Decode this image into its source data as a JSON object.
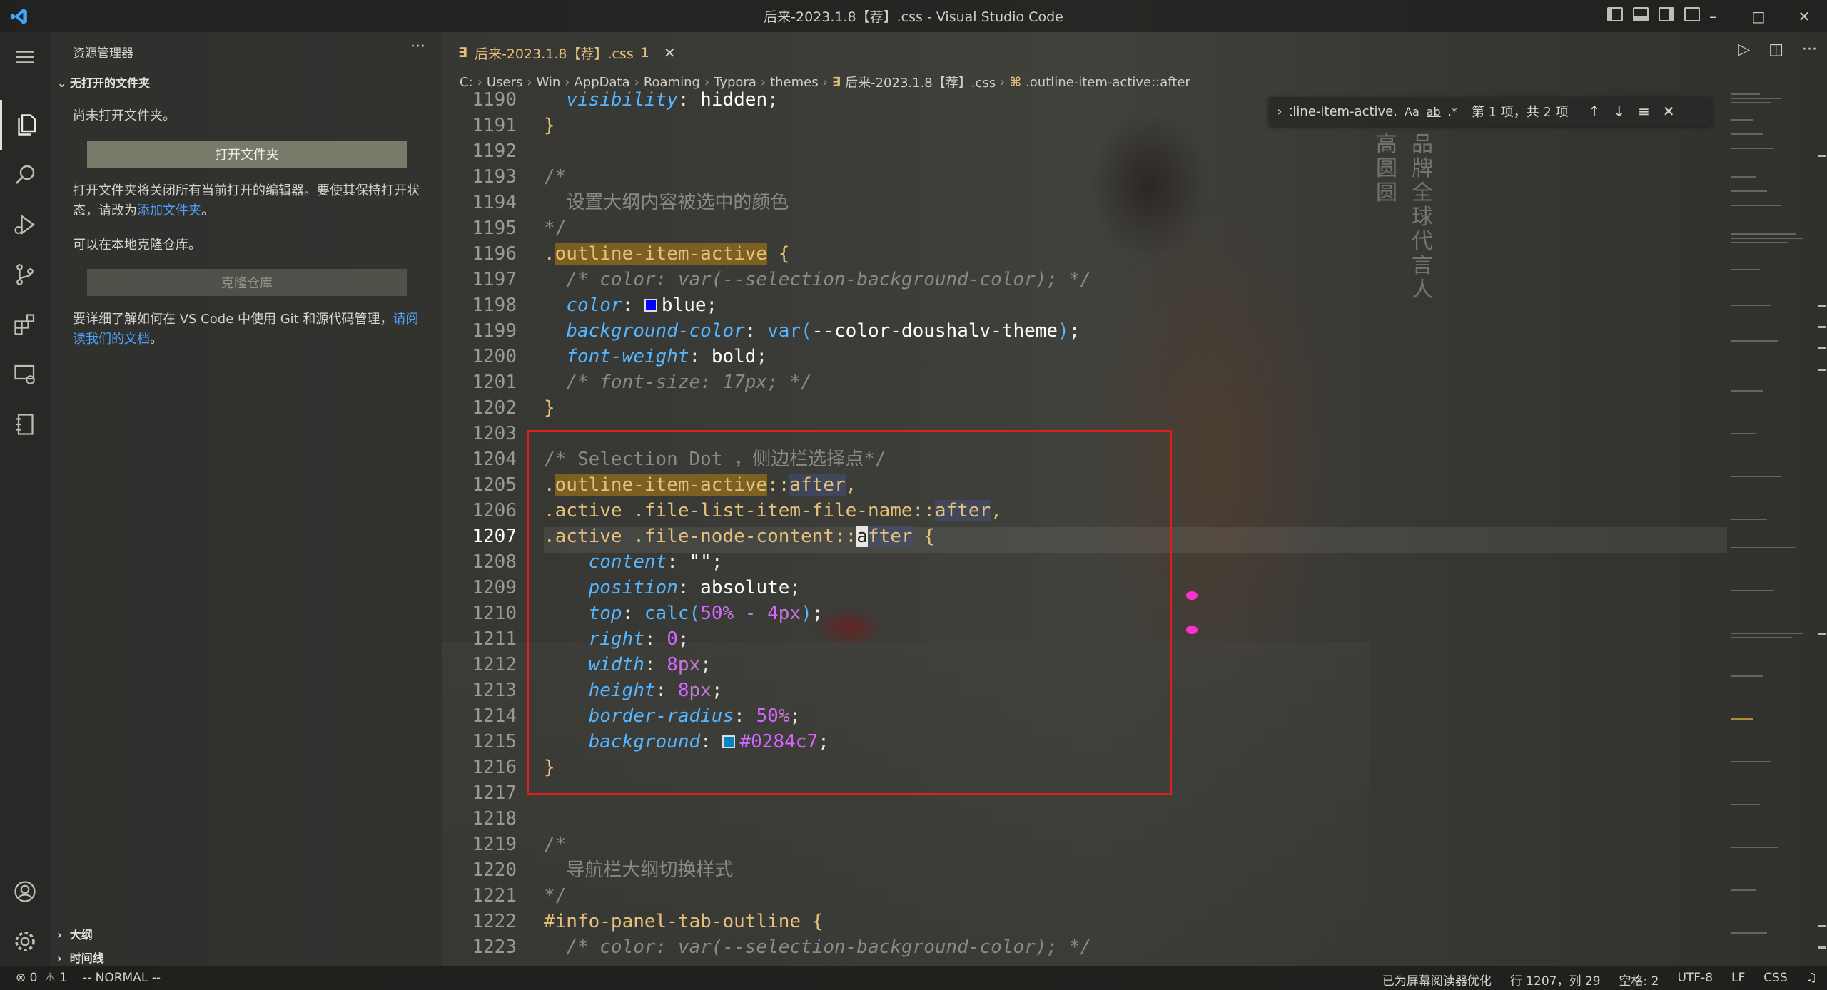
{
  "window": {
    "title": "后来-2023.1.8【荐】.css - Visual Studio Code",
    "controls": {
      "minimize": "–",
      "maximize": "□",
      "close": "✕"
    }
  },
  "sidebar": {
    "title": "资源管理器",
    "more": "···",
    "section_title": "无打开的文件夹",
    "no_folder_text": "尚未打开文件夹。",
    "open_folder_button": "打开文件夹",
    "info_text_1": "打开文件夹将关闭所有当前打开的编辑器。要使其保持打开状态，请改为",
    "add_folder_link": "添加文件夹",
    "info_text_1_end": "。",
    "clone_text": "可以在本地克隆仓库。",
    "clone_button": "克隆仓库",
    "git_text": "要详细了解如何在 VS Code 中使用 Git 和源代码管理，",
    "docs_link": "请阅读我们的文档",
    "docs_end": "。",
    "outline_label": "大纲",
    "timeline_label": "时间线"
  },
  "tab": {
    "icon": "∃",
    "label": "后来-2023.1.8【荐】.css",
    "badge": "1",
    "close": "✕"
  },
  "breadcrumb": {
    "parts": [
      "C:",
      "Users",
      "Win",
      "AppData",
      "Roaming",
      "Typora",
      "themes"
    ],
    "file": "后来-2023.1.8【荐】.css",
    "symbol": ".outline-item-active::after",
    "file_icon": "∃",
    "symbol_icon": "⌘"
  },
  "find": {
    "value": ".outline-item-active",
    "opt_case": "Aa",
    "opt_word": "ab",
    "opt_regex": ".*",
    "count": "第 1 项，共 2 项",
    "prev": "↑",
    "next": "↓",
    "selection": "≡",
    "close": "✕"
  },
  "watermark": {
    "col1": "品牌全球代言人",
    "col2": "高圆圆"
  },
  "code": {
    "line_numbers": [
      "1190",
      "1191",
      "1192",
      "1193",
      "1194",
      "1195",
      "1196",
      "1197",
      "1198",
      "1199",
      "1200",
      "1201",
      "1202",
      "1203",
      "1204",
      "1205",
      "1206",
      "1207",
      "1208",
      "1209",
      "1210",
      "1211",
      "1212",
      "1213",
      "1214",
      "1215",
      "1216",
      "1217",
      "1218",
      "1219",
      "1220",
      "1221",
      "1222",
      "1223"
    ],
    "current_line": "1207",
    "t": {
      "visibility": "visibility",
      "hidden": "hidden",
      "semi": ";",
      "colon": ": ",
      "brace_close": "}",
      "brace_open": "{",
      "comment_open": "/*",
      "comment_close": "*/",
      "comment_1194": "设置大纲内容被选中的颜色",
      "dot": ".",
      "outline_item_active": "outline-item-active",
      "comment_1197": "/* color: var(--selection-background-color); */",
      "color": "color",
      "blue": "blue",
      "background_color": "background-color",
      "var_open": "var(",
      "var_name": "--color-doushalv-theme",
      "paren_close": ")",
      "font_weight": "font-weight",
      "bold": "bold",
      "comment_1201": "/* font-size: 17px; */",
      "comment_1204": "/* Selection Dot ，侧边栏选择点*/",
      "dcolon": "::",
      "after": "after",
      "comma": ",",
      "active_file_list": ".active .file-list-item-file-name::",
      "active_file_node": ".active .file-node-content::",
      "cursor_char": "a",
      "after_rest": "fter",
      "content": "content",
      "empty_str": "\"\"",
      "position": "position",
      "absolute": "absolute",
      "top": "top",
      "calc_open": "calc(",
      "fifty": "50",
      "pct": "%",
      "minus": " - ",
      "four": "4",
      "px": "px",
      "right": "right",
      "zero": "0",
      "width": "width",
      "eight": "8",
      "height": "height",
      "border_radius": "border-radius",
      "background": "background",
      "hex": "#0284c7",
      "comment_1220": "导航栏大纲切换样式",
      "info_panel": "#info-panel-tab-outline"
    },
    "swatches": {
      "blue": "#0000ff",
      "hex": "#0284c7"
    }
  },
  "status": {
    "errors": "⊗ 0",
    "warnings": "⚠ 1",
    "mode": "-- NORMAL --",
    "screen_reader": "已为屏幕阅读器优化",
    "position": "行 1207，列 29",
    "spaces": "空格: 2",
    "encoding": "UTF-8",
    "eol": "LF",
    "language": "CSS",
    "notif": "♫"
  },
  "colors": {
    "accent_link": "#4ea3ff",
    "highlight_box": "#e01e1e",
    "tab_text": "#e5c07b"
  }
}
